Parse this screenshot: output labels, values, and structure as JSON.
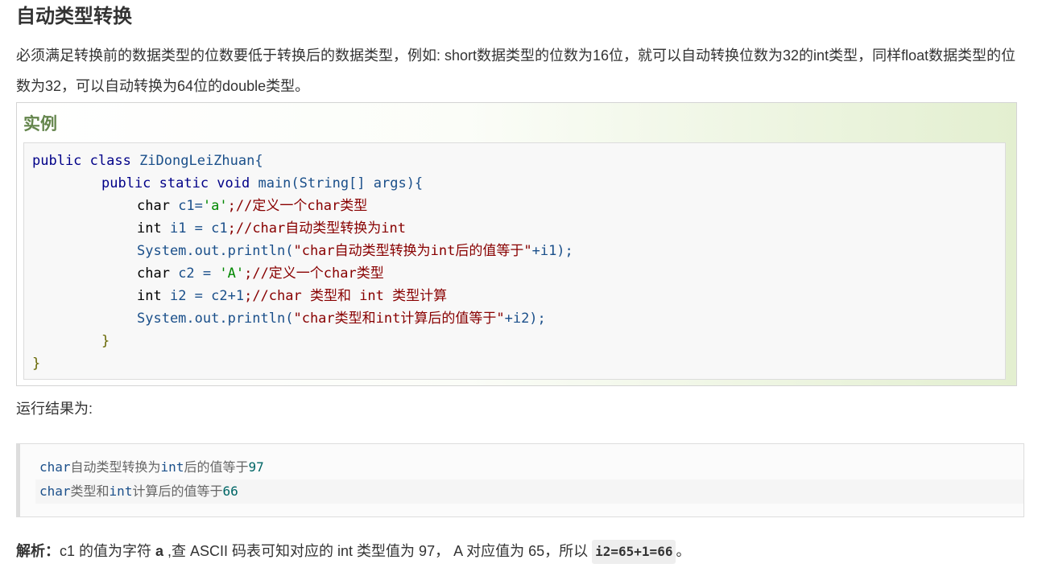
{
  "article": {
    "title": "自动类型转换",
    "intro": "必须满足转换前的数据类型的位数要低于转换后的数据类型，例如: short数据类型的位数为16位，就可以自动转换位数为32的int类型，同样float数据类型的位数为32，可以自动转换为64位的double类型。"
  },
  "example": {
    "heading": "实例",
    "code": {
      "l1": {
        "a": "public class ",
        "b": "ZiDongLeiZhuan{"
      },
      "l2": {
        "a": "public static void ",
        "b": "main(String[] args){"
      },
      "l3": {
        "a": "char ",
        "b": "c1=",
        "c": "'a'",
        "d": ";//定义一个char类型"
      },
      "l4": {
        "a": "int ",
        "b": "i1 = c1",
        "c": ";//char自动类型转换为int"
      },
      "l5": {
        "a": "System.out.println(",
        "b": "\"char自动类型转换为int后的值等于\"",
        "c": "+i1);"
      },
      "l6": {
        "a": "char ",
        "b": "c2 = ",
        "c": "'A'",
        "d": ";//定义一个char类型"
      },
      "l7": {
        "a": "int ",
        "b": "i2 = c2+1",
        "c": ";//char 类型和 int 类型计算"
      },
      "l8": {
        "a": "System.out.println(",
        "b": "\"char类型和int计算后的值等于\"",
        "c": "+i2);"
      },
      "l9": "}",
      "l10": "}"
    }
  },
  "result": {
    "label": "运行结果为:",
    "lines": [
      {
        "pre": "char",
        "mid": "自动类型转换为",
        "kw": "int",
        "post": "后的值等于",
        "num": "97"
      },
      {
        "pre": "char",
        "mid": "类型和",
        "kw": "int",
        "post": "计算后的值等于",
        "num": "66"
      }
    ]
  },
  "analysis": {
    "label": "解析：",
    "text1": "c1 的值为字符 ",
    "char": "a",
    "text2": " ,查 ASCII 码表可知对应的 int 类型值为 97， A 对应值为 65，所以 ",
    "code": "i2=65+1=66",
    "end": "。"
  }
}
